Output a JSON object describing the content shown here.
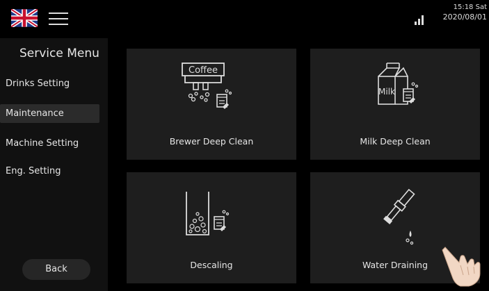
{
  "header": {
    "language_icon": "uk-flag-icon",
    "menu_icon": "hamburger-menu-icon",
    "signal_icon": "signal-strength-icon",
    "time": "15:18 Sat",
    "date": "2020/08/01"
  },
  "sidebar": {
    "title": "Service Menu",
    "items": [
      {
        "label": "Drinks Setting",
        "active": false
      },
      {
        "label": "Maintenance",
        "active": true
      },
      {
        "label": "Machine Setting",
        "active": false
      },
      {
        "label": "Eng. Setting",
        "active": false
      }
    ],
    "back_label": "Back"
  },
  "cards": [
    {
      "label": "Brewer Deep Clean",
      "icon": "coffee-brewer-clean-icon",
      "icon_text": "Coffee"
    },
    {
      "label": "Milk Deep Clean",
      "icon": "milk-carton-clean-icon",
      "icon_text": "Milk"
    },
    {
      "label": "Descaling",
      "icon": "descaling-tank-icon"
    },
    {
      "label": "Water Draining",
      "icon": "water-drain-valve-icon"
    }
  ],
  "colors": {
    "background": "#000000",
    "sidebar": "#111111",
    "card": "#1e1e1e",
    "active_item": "#2b2b2b",
    "text": "#e6e6e6"
  }
}
